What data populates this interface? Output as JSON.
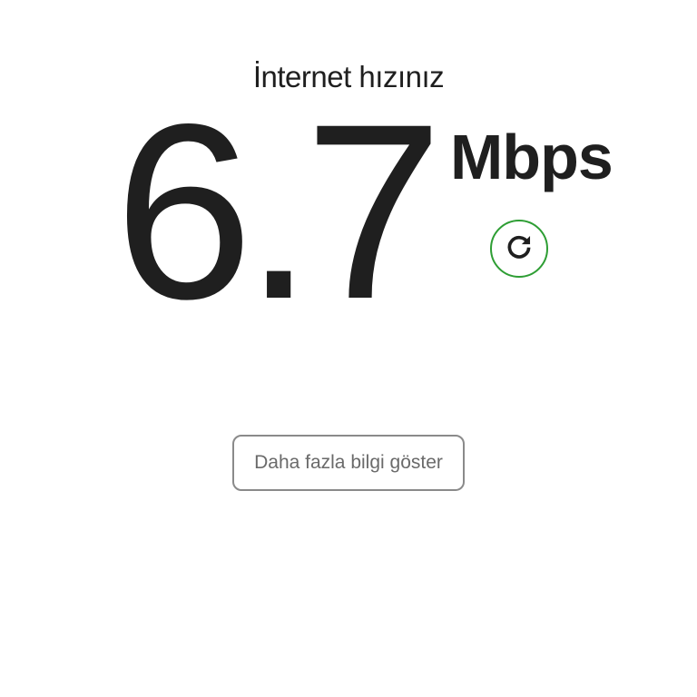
{
  "header": {
    "title": "İnternet hızınız"
  },
  "result": {
    "speed_value": "6.7",
    "unit": "Mbps"
  },
  "actions": {
    "refresh_icon": "refresh-icon",
    "more_info_label": "Daha fazla bilgi göster"
  },
  "colors": {
    "accent": "#2e9e34",
    "text": "#1f1f1f",
    "button_border": "#8a8a8a"
  }
}
